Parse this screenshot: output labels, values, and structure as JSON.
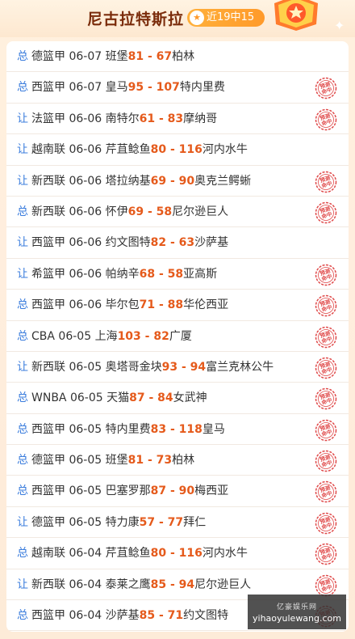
{
  "header": {
    "title": "尼古拉特斯拉",
    "badge": "近19中15",
    "colors": {
      "title": "#7a2b0a",
      "badge": "#ff9a2a",
      "score": "#e55a1b",
      "type": "#3b7ddd",
      "stamp": "#e04b4b"
    }
  },
  "rows": [
    {
      "type": "总",
      "league": "德篮甲",
      "date": "06-07",
      "home": "班堡",
      "home_score": "81",
      "away_score": "67",
      "away": "柏林",
      "predicted": false
    },
    {
      "type": "总",
      "league": "西篮甲",
      "date": "06-07",
      "home": "皇马",
      "home_score": "95",
      "away_score": "107",
      "away": "特内里费",
      "predicted": true
    },
    {
      "type": "让",
      "league": "法篮甲",
      "date": "06-06",
      "home": "南特尔",
      "home_score": "61",
      "away_score": "83",
      "away": "摩纳哥",
      "predicted": true
    },
    {
      "type": "让",
      "league": "越南联",
      "date": "06-06",
      "home": "芹苴鲶鱼",
      "home_score": "80",
      "away_score": "116",
      "away": "河内水牛",
      "predicted": false
    },
    {
      "type": "让",
      "league": "新西联",
      "date": "06-06",
      "home": "塔拉纳基",
      "home_score": "69",
      "away_score": "90",
      "away": "奥克兰鳄蜥",
      "predicted": true
    },
    {
      "type": "总",
      "league": "新西联",
      "date": "06-06",
      "home": "怀伊",
      "home_score": "69",
      "away_score": "58",
      "away": "尼尔逊巨人",
      "predicted": true
    },
    {
      "type": "让",
      "league": "西篮甲",
      "date": "06-06",
      "home": "约文图特",
      "home_score": "82",
      "away_score": "63",
      "away": "沙萨基",
      "predicted": false
    },
    {
      "type": "让",
      "league": "希篮甲",
      "date": "06-06",
      "home": "帕纳辛",
      "home_score": "68",
      "away_score": "58",
      "away": "亚高斯",
      "predicted": true
    },
    {
      "type": "总",
      "league": "西篮甲",
      "date": "06-06",
      "home": "毕尔包",
      "home_score": "71",
      "away_score": "88",
      "away": "华伦西亚",
      "predicted": true
    },
    {
      "type": "总",
      "league": "CBA",
      "date": "06-05",
      "home": "上海",
      "home_score": "103",
      "away_score": "82",
      "away": "广厦",
      "predicted": true
    },
    {
      "type": "让",
      "league": "新西联",
      "date": "06-05",
      "home": "奥塔哥金块",
      "home_score": "93",
      "away_score": "94",
      "away": "富兰克林公牛",
      "predicted": true
    },
    {
      "type": "总",
      "league": "WNBA",
      "date": "06-05",
      "home": "天猫",
      "home_score": "87",
      "away_score": "84",
      "away": "女武神",
      "predicted": true
    },
    {
      "type": "总",
      "league": "西篮甲",
      "date": "06-05",
      "home": "特内里费",
      "home_score": "83",
      "away_score": "118",
      "away": "皇马",
      "predicted": true
    },
    {
      "type": "总",
      "league": "德篮甲",
      "date": "06-05",
      "home": "班堡",
      "home_score": "81",
      "away_score": "73",
      "away": "柏林",
      "predicted": true
    },
    {
      "type": "总",
      "league": "西篮甲",
      "date": "06-05",
      "home": "巴塞罗那",
      "home_score": "87",
      "away_score": "90",
      "away": "梅西亚",
      "predicted": true
    },
    {
      "type": "让",
      "league": "德篮甲",
      "date": "06-05",
      "home": "特力康",
      "home_score": "57",
      "away_score": "77",
      "away": "拜仁",
      "predicted": true
    },
    {
      "type": "总",
      "league": "越南联",
      "date": "06-04",
      "home": "芹苴鲶鱼",
      "home_score": "80",
      "away_score": "116",
      "away": "河内水牛",
      "predicted": true
    },
    {
      "type": "让",
      "league": "新西联",
      "date": "06-04",
      "home": "泰莱之鹰",
      "home_score": "85",
      "away_score": "94",
      "away": "尼尔逊巨人",
      "predicted": true
    },
    {
      "type": "总",
      "league": "西篮甲",
      "date": "06-04",
      "home": "沙萨基",
      "home_score": "85",
      "away_score": "71",
      "away": "约文图特",
      "predicted": true
    }
  ],
  "stamp": {
    "text": "预测命中"
  },
  "watermark": {
    "top": "亿豪娱乐网",
    "bottom": "yihaoyulewang.com"
  }
}
